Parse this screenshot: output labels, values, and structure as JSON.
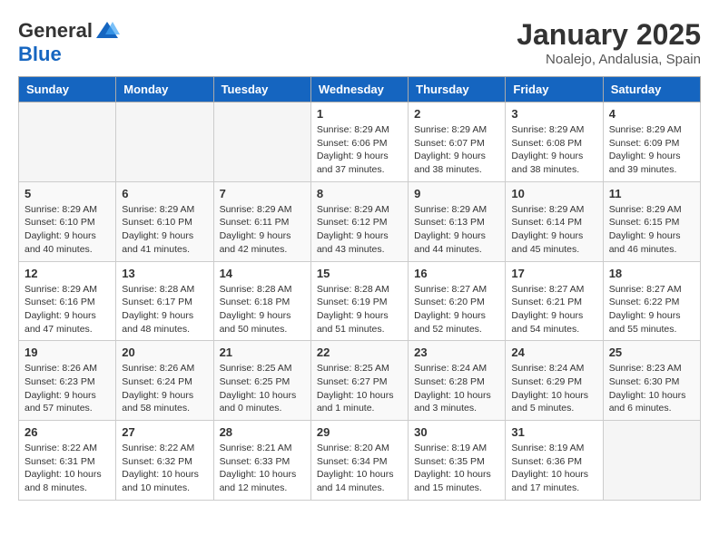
{
  "logo": {
    "general": "General",
    "blue": "Blue"
  },
  "title": "January 2025",
  "subtitle": "Noalejo, Andalusia, Spain",
  "days_header": [
    "Sunday",
    "Monday",
    "Tuesday",
    "Wednesday",
    "Thursday",
    "Friday",
    "Saturday"
  ],
  "weeks": [
    [
      {
        "day": "",
        "info": ""
      },
      {
        "day": "",
        "info": ""
      },
      {
        "day": "",
        "info": ""
      },
      {
        "day": "1",
        "info": "Sunrise: 8:29 AM\nSunset: 6:06 PM\nDaylight: 9 hours and 37 minutes."
      },
      {
        "day": "2",
        "info": "Sunrise: 8:29 AM\nSunset: 6:07 PM\nDaylight: 9 hours and 38 minutes."
      },
      {
        "day": "3",
        "info": "Sunrise: 8:29 AM\nSunset: 6:08 PM\nDaylight: 9 hours and 38 minutes."
      },
      {
        "day": "4",
        "info": "Sunrise: 8:29 AM\nSunset: 6:09 PM\nDaylight: 9 hours and 39 minutes."
      }
    ],
    [
      {
        "day": "5",
        "info": "Sunrise: 8:29 AM\nSunset: 6:10 PM\nDaylight: 9 hours and 40 minutes."
      },
      {
        "day": "6",
        "info": "Sunrise: 8:29 AM\nSunset: 6:10 PM\nDaylight: 9 hours and 41 minutes."
      },
      {
        "day": "7",
        "info": "Sunrise: 8:29 AM\nSunset: 6:11 PM\nDaylight: 9 hours and 42 minutes."
      },
      {
        "day": "8",
        "info": "Sunrise: 8:29 AM\nSunset: 6:12 PM\nDaylight: 9 hours and 43 minutes."
      },
      {
        "day": "9",
        "info": "Sunrise: 8:29 AM\nSunset: 6:13 PM\nDaylight: 9 hours and 44 minutes."
      },
      {
        "day": "10",
        "info": "Sunrise: 8:29 AM\nSunset: 6:14 PM\nDaylight: 9 hours and 45 minutes."
      },
      {
        "day": "11",
        "info": "Sunrise: 8:29 AM\nSunset: 6:15 PM\nDaylight: 9 hours and 46 minutes."
      }
    ],
    [
      {
        "day": "12",
        "info": "Sunrise: 8:29 AM\nSunset: 6:16 PM\nDaylight: 9 hours and 47 minutes."
      },
      {
        "day": "13",
        "info": "Sunrise: 8:28 AM\nSunset: 6:17 PM\nDaylight: 9 hours and 48 minutes."
      },
      {
        "day": "14",
        "info": "Sunrise: 8:28 AM\nSunset: 6:18 PM\nDaylight: 9 hours and 50 minutes."
      },
      {
        "day": "15",
        "info": "Sunrise: 8:28 AM\nSunset: 6:19 PM\nDaylight: 9 hours and 51 minutes."
      },
      {
        "day": "16",
        "info": "Sunrise: 8:27 AM\nSunset: 6:20 PM\nDaylight: 9 hours and 52 minutes."
      },
      {
        "day": "17",
        "info": "Sunrise: 8:27 AM\nSunset: 6:21 PM\nDaylight: 9 hours and 54 minutes."
      },
      {
        "day": "18",
        "info": "Sunrise: 8:27 AM\nSunset: 6:22 PM\nDaylight: 9 hours and 55 minutes."
      }
    ],
    [
      {
        "day": "19",
        "info": "Sunrise: 8:26 AM\nSunset: 6:23 PM\nDaylight: 9 hours and 57 minutes."
      },
      {
        "day": "20",
        "info": "Sunrise: 8:26 AM\nSunset: 6:24 PM\nDaylight: 9 hours and 58 minutes."
      },
      {
        "day": "21",
        "info": "Sunrise: 8:25 AM\nSunset: 6:25 PM\nDaylight: 10 hours and 0 minutes."
      },
      {
        "day": "22",
        "info": "Sunrise: 8:25 AM\nSunset: 6:27 PM\nDaylight: 10 hours and 1 minute."
      },
      {
        "day": "23",
        "info": "Sunrise: 8:24 AM\nSunset: 6:28 PM\nDaylight: 10 hours and 3 minutes."
      },
      {
        "day": "24",
        "info": "Sunrise: 8:24 AM\nSunset: 6:29 PM\nDaylight: 10 hours and 5 minutes."
      },
      {
        "day": "25",
        "info": "Sunrise: 8:23 AM\nSunset: 6:30 PM\nDaylight: 10 hours and 6 minutes."
      }
    ],
    [
      {
        "day": "26",
        "info": "Sunrise: 8:22 AM\nSunset: 6:31 PM\nDaylight: 10 hours and 8 minutes."
      },
      {
        "day": "27",
        "info": "Sunrise: 8:22 AM\nSunset: 6:32 PM\nDaylight: 10 hours and 10 minutes."
      },
      {
        "day": "28",
        "info": "Sunrise: 8:21 AM\nSunset: 6:33 PM\nDaylight: 10 hours and 12 minutes."
      },
      {
        "day": "29",
        "info": "Sunrise: 8:20 AM\nSunset: 6:34 PM\nDaylight: 10 hours and 14 minutes."
      },
      {
        "day": "30",
        "info": "Sunrise: 8:19 AM\nSunset: 6:35 PM\nDaylight: 10 hours and 15 minutes."
      },
      {
        "day": "31",
        "info": "Sunrise: 8:19 AM\nSunset: 6:36 PM\nDaylight: 10 hours and 17 minutes."
      },
      {
        "day": "",
        "info": ""
      }
    ]
  ]
}
